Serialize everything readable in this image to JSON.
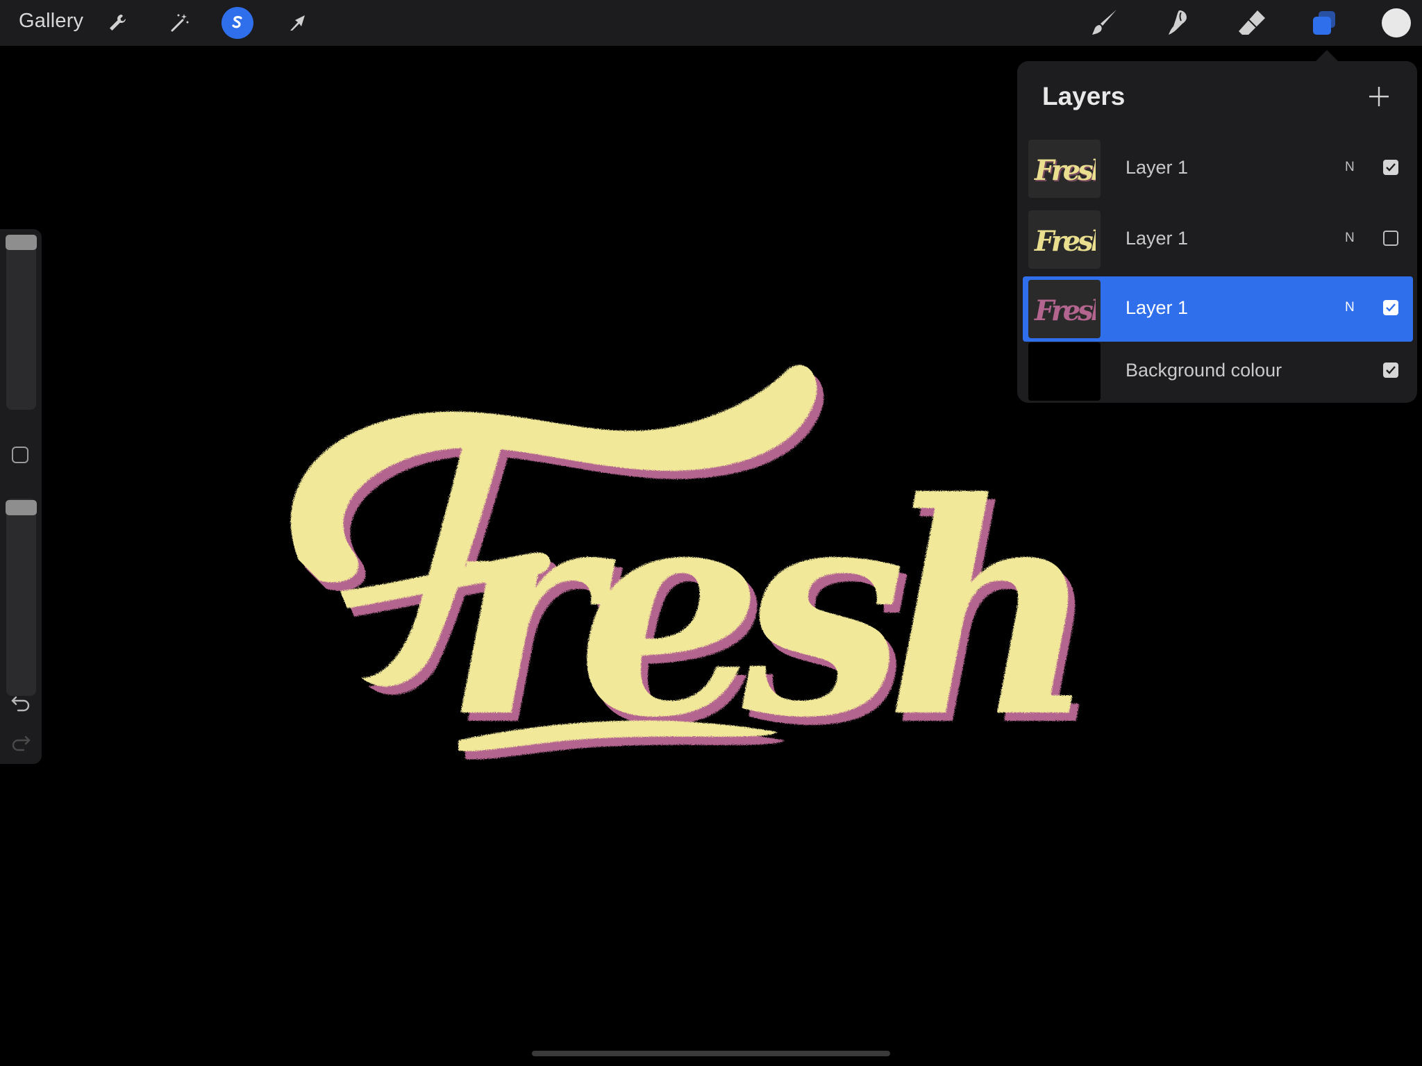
{
  "topbar": {
    "gallery_label": "Gallery",
    "left_tools": [
      "wrench-icon",
      "magic-wand-icon",
      "selection-icon",
      "transform-arrow-icon"
    ],
    "right_tools": [
      "brush-icon",
      "smudge-icon",
      "eraser-icon",
      "layers-icon",
      "color-swatch"
    ],
    "active_tool_color": "#2f6fec",
    "current_color": "#e8e8e8"
  },
  "canvas": {
    "artwork_text": "Fresh",
    "fill_color": "#f2e89a",
    "shadow_color": "#b4658f",
    "background": "#000000"
  },
  "sidebar": {
    "brush_size_level": 0.03,
    "opacity_level": 0.03,
    "buttons": [
      "modify-button",
      "undo-icon",
      "redo-icon"
    ]
  },
  "layers_panel": {
    "title": "Layers",
    "add_label": "+",
    "layers": [
      {
        "name": "Layer 1",
        "blend": "N",
        "visible": true,
        "active": false,
        "thumb_text": "Fresh",
        "thumb_color": "#e9df8f"
      },
      {
        "name": "Layer 1",
        "blend": "N",
        "visible": false,
        "active": false,
        "thumb_text": "Fresh",
        "thumb_color": "#e9df8f"
      },
      {
        "name": "Layer 1",
        "blend": "N",
        "visible": true,
        "active": true,
        "thumb_text": "Fresh",
        "thumb_color": "#b4658f"
      },
      {
        "name": "Background colour",
        "blend": "",
        "visible": true,
        "active": false,
        "thumb_text": "",
        "thumb_color": "#000000"
      }
    ]
  }
}
